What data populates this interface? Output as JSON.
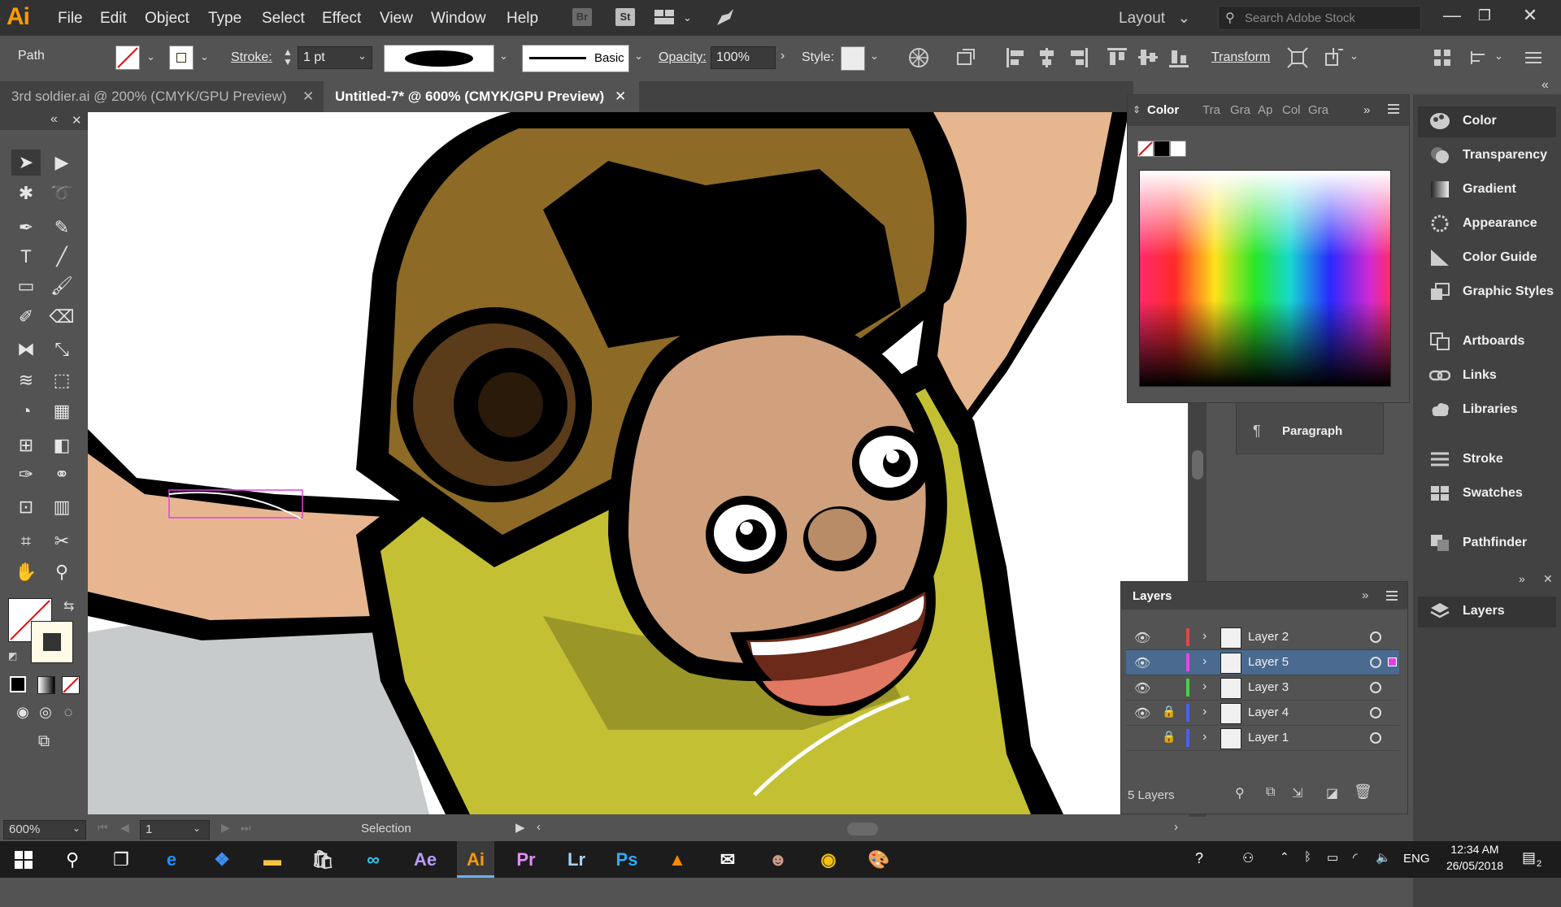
{
  "app": {
    "logo": "Ai"
  },
  "menu": [
    "File",
    "Edit",
    "Object",
    "Type",
    "Select",
    "Effect",
    "View",
    "Window",
    "Help"
  ],
  "menubar_icons": [
    "Br",
    "St"
  ],
  "workspace": {
    "label": "Layout",
    "arrow": "⌄"
  },
  "stock_search": {
    "placeholder": "Search Adobe Stock"
  },
  "window_controls": {
    "minimize": "—",
    "restore": "❐",
    "close": "✕"
  },
  "control": {
    "selection_type": "Path",
    "stroke_label": "Stroke:",
    "stroke_weight": "1 pt",
    "profile_label": "Basic",
    "opacity_label": "Opacity:",
    "opacity_value": "100%",
    "style_label": "Style:",
    "transform_label": "Transform"
  },
  "tabs": [
    {
      "label": "3rd soldier.ai @ 200% (CMYK/GPU Preview)",
      "close": "✕",
      "active": false
    },
    {
      "label": "Untitled-7* @ 600% (CMYK/GPU Preview)",
      "close": "✕",
      "active": true
    }
  ],
  "toolbox": {
    "collapse": "«",
    "close": "✕"
  },
  "color_panel": {
    "title": "Color",
    "other_tabs": [
      "Tra",
      "Gra",
      "Ap",
      "Col",
      "Gra"
    ],
    "more": "»",
    "behind_panel_item": "Paragraph"
  },
  "dock": {
    "collapse": "«",
    "group1": [
      "Color",
      "Transparency",
      "Gradient",
      "Appearance",
      "Color Guide",
      "Graphic Styles"
    ],
    "group2": [
      "Artboards",
      "Links",
      "Libraries"
    ],
    "group3": [
      "Stroke",
      "Swatches"
    ],
    "group4": [
      "Pathfinder"
    ],
    "group5": [
      "Layers"
    ]
  },
  "layers_panel": {
    "title": "Layers",
    "more": "»",
    "count_label": "5 Layers",
    "layers": [
      {
        "name": "Layer 2",
        "color": "#e04848",
        "visible": true,
        "locked": false,
        "selected": false
      },
      {
        "name": "Layer 5",
        "color": "#e04be0",
        "visible": true,
        "locked": false,
        "selected": true
      },
      {
        "name": "Layer 3",
        "color": "#48d048",
        "visible": true,
        "locked": false,
        "selected": false
      },
      {
        "name": "Layer 4",
        "color": "#4a62e6",
        "visible": true,
        "locked": true,
        "selected": false
      },
      {
        "name": "Layer 1",
        "color": "#4a62e6",
        "visible": false,
        "locked": true,
        "selected": false
      }
    ]
  },
  "status": {
    "zoom": "600%",
    "artboard": "1",
    "tool": "Selection"
  },
  "taskbar": {
    "language": "ENG",
    "time": "12:34 AM",
    "date": "26/05/2018",
    "notifications": "2",
    "apps": [
      "Ae",
      "Ai",
      "Pr",
      "Lr",
      "Ps"
    ]
  },
  "colors": {
    "accent": "#ff9a00",
    "ui_dark": "#323232",
    "ui_mid": "#535353",
    "selection": "#e040e0"
  }
}
